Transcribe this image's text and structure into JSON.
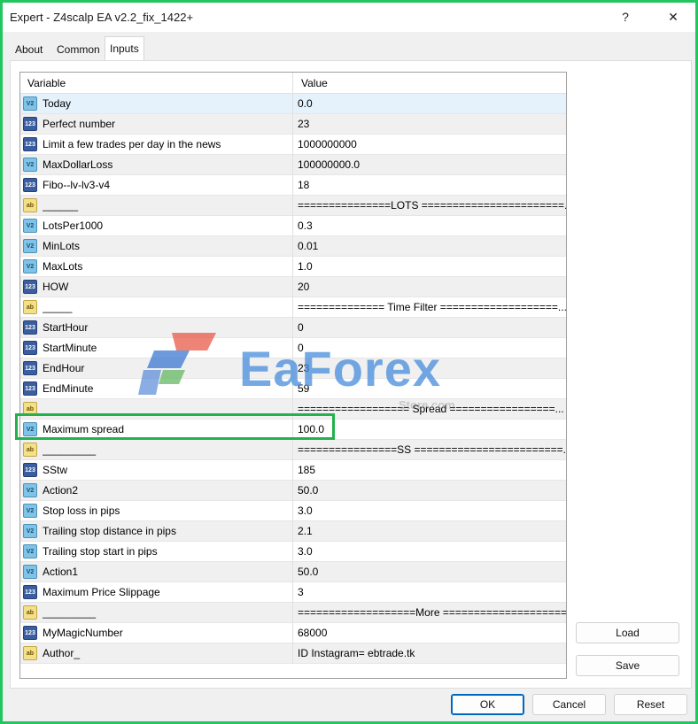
{
  "window": {
    "title": "Expert - Z4scalp EA v2.2_fix_1422+",
    "help_label": "?",
    "close_label": "✕"
  },
  "tabs": [
    {
      "label": "About",
      "active": false
    },
    {
      "label": "Common",
      "active": false
    },
    {
      "label": "Inputs",
      "active": true
    }
  ],
  "grid": {
    "columns": {
      "variable": "Variable",
      "value": "Value"
    },
    "rows": [
      {
        "icon": "double-icon",
        "badge": "V2",
        "name": "Today",
        "value": "0.0"
      },
      {
        "icon": "integer-icon",
        "badge": "123",
        "name": "Perfect number",
        "value": "23"
      },
      {
        "icon": "integer-icon",
        "badge": "123",
        "name": "Limit a few trades per day in the news",
        "value": "1000000000"
      },
      {
        "icon": "double-icon",
        "badge": "V2",
        "name": "MaxDollarLoss",
        "value": "100000000.0"
      },
      {
        "icon": "integer-icon",
        "badge": "123",
        "name": "Fibo--lv-lv3-v4",
        "value": "18"
      },
      {
        "icon": "string-icon",
        "badge": "ab",
        "name": "______",
        "value": "===============LOTS =======================..."
      },
      {
        "icon": "double-icon",
        "badge": "V2",
        "name": "LotsPer1000",
        "value": "0.3"
      },
      {
        "icon": "double-icon",
        "badge": "V2",
        "name": "MinLots",
        "value": "0.01"
      },
      {
        "icon": "double-icon",
        "badge": "V2",
        "name": "MaxLots",
        "value": "1.0"
      },
      {
        "icon": "integer-icon",
        "badge": "123",
        "name": "HOW",
        "value": "20"
      },
      {
        "icon": "string-icon",
        "badge": "ab",
        "name": "_____",
        "value": "============== Time Filter ===================..."
      },
      {
        "icon": "integer-icon",
        "badge": "123",
        "name": "StartHour",
        "value": "0"
      },
      {
        "icon": "integer-icon",
        "badge": "123",
        "name": "StartMinute",
        "value": "0"
      },
      {
        "icon": "integer-icon",
        "badge": "123",
        "name": "EndHour",
        "value": "23"
      },
      {
        "icon": "integer-icon",
        "badge": "123",
        "name": "EndMinute",
        "value": "59"
      },
      {
        "icon": "string-icon",
        "badge": "ab",
        "name": "",
        "value": "================== Spread =================..."
      },
      {
        "icon": "double-icon",
        "badge": "V2",
        "name": "Maximum spread",
        "value": "100.0"
      },
      {
        "icon": "string-icon",
        "badge": "ab",
        "name": "_________",
        "value": "================SS ========================..."
      },
      {
        "icon": "integer-icon",
        "badge": "123",
        "name": "SStw",
        "value": "185"
      },
      {
        "icon": "double-icon",
        "badge": "V2",
        "name": "Action2",
        "value": "50.0"
      },
      {
        "icon": "double-icon",
        "badge": "V2",
        "name": "Stop loss in pips",
        "value": "3.0"
      },
      {
        "icon": "double-icon",
        "badge": "V2",
        "name": "Trailing stop distance in pips",
        "value": "2.1"
      },
      {
        "icon": "double-icon",
        "badge": "V2",
        "name": "Trailing stop start in pips",
        "value": "3.0"
      },
      {
        "icon": "double-icon",
        "badge": "V2",
        "name": "Action1",
        "value": "50.0"
      },
      {
        "icon": "integer-icon",
        "badge": "123",
        "name": "Maximum Price Slippage",
        "value": "3"
      },
      {
        "icon": "string-icon",
        "badge": "ab",
        "name": "_________",
        "value": "===================More ====================..."
      },
      {
        "icon": "integer-icon",
        "badge": "123",
        "name": "MyMagicNumber",
        "value": "68000"
      },
      {
        "icon": "string-icon",
        "badge": "ab",
        "name": "Author_",
        "value": " ID Instagram= ebtrade.tk"
      }
    ]
  },
  "watermark": {
    "text": "EaForex",
    "sub": "Store.com"
  },
  "buttons": {
    "load": "Load",
    "save": "Save",
    "ok": "OK",
    "cancel": "Cancel",
    "reset": "Reset"
  },
  "colors": {
    "highlight": "#22b14c",
    "frame": "#22c55e",
    "ok_border": "#0067c0"
  }
}
